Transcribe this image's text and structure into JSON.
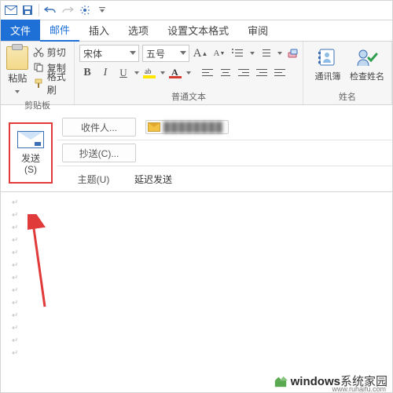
{
  "qat": {
    "icons": [
      "mail-icon",
      "save-icon",
      "undo-icon",
      "redo-icon",
      "touch-mode-icon",
      "customize-qat-icon"
    ]
  },
  "tabs": {
    "file": "文件",
    "items": [
      "邮件",
      "插入",
      "选项",
      "设置文本格式",
      "审阅"
    ],
    "active": 0
  },
  "ribbon": {
    "clipboard": {
      "paste": "粘贴",
      "cut": "剪切",
      "copy": "复制",
      "format_painter": "格式刷",
      "group_label": "剪贴板"
    },
    "font": {
      "font_name": "宋体",
      "font_size": "五号",
      "grow": "A",
      "shrink": "A",
      "bold": "B",
      "italic": "I",
      "underline": "U",
      "group_label": "普通文本"
    },
    "names": {
      "address_book": "通讯簿",
      "check_names": "检查姓名",
      "group_label": "姓名"
    }
  },
  "mail": {
    "send_label_1": "发送",
    "send_label_2": "(S)",
    "to_label": "收件人...",
    "cc_label": "抄送(C)...",
    "subject_label": "主题(U)",
    "to_value": "████████",
    "subject_value": "延迟发送"
  },
  "watermark": {
    "text_bold": "windows",
    "text_rest": "系统家园",
    "sub": "www.ruhaifu.com"
  }
}
